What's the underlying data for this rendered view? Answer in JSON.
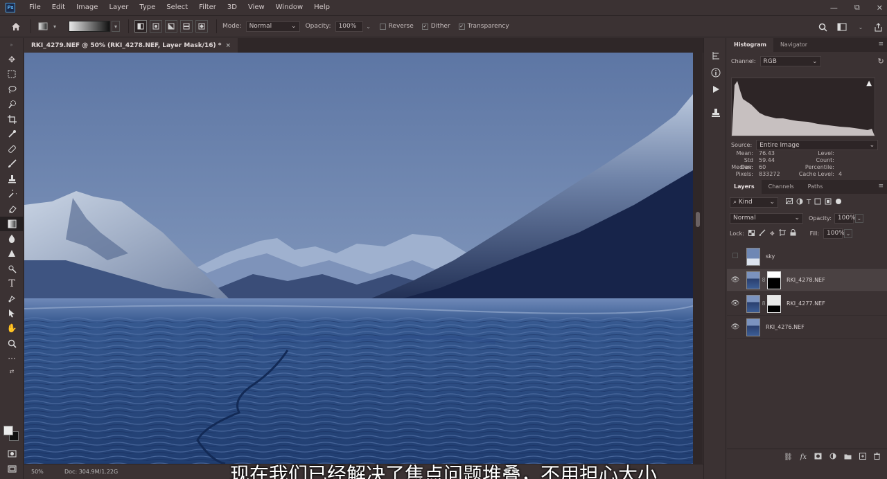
{
  "app": {
    "logo": "Ps"
  },
  "menu": [
    "File",
    "Edit",
    "Image",
    "Layer",
    "Type",
    "Select",
    "Filter",
    "3D",
    "View",
    "Window",
    "Help"
  ],
  "window_controls": [
    "—",
    "⧉",
    "✕"
  ],
  "options": {
    "mode_label": "Mode:",
    "mode_value": "Normal",
    "opacity_label": "Opacity:",
    "opacity_value": "100%",
    "reverse_label": "Reverse",
    "dither_label": "Dither",
    "transparency_label": "Transparency",
    "reverse_checked": false,
    "dither_checked": true,
    "transparency_checked": true
  },
  "document": {
    "tab_title": "RKI_4279.NEF @ 50% (RKI_4278.NEF, Layer Mask/16) *",
    "close": "×"
  },
  "status": {
    "zoom": "50%",
    "doc": "Doc: 304.9M/1.22G"
  },
  "subtitle": "现在我们已经解决了焦点问题堆叠，不用担心大小",
  "histogram": {
    "tabs": [
      "Histogram",
      "Navigator"
    ],
    "channel_label": "Channel:",
    "channel_value": "RGB",
    "source_label": "Source:",
    "source_value": "Entire Image",
    "stats_left": [
      {
        "label": "Mean:",
        "value": "76.43"
      },
      {
        "label": "Std Dev:",
        "value": "59.44"
      },
      {
        "label": "Median:",
        "value": "60"
      },
      {
        "label": "Pixels:",
        "value": "833272"
      }
    ],
    "stats_right": [
      {
        "label": "Level:",
        "value": ""
      },
      {
        "label": "Count:",
        "value": ""
      },
      {
        "label": "Percentile:",
        "value": ""
      },
      {
        "label": "Cache Level:",
        "value": "4"
      }
    ]
  },
  "layers": {
    "tabs": [
      "Layers",
      "Channels",
      "Paths"
    ],
    "filter_kind": "Kind",
    "blend_mode": "Normal",
    "opacity_label": "Opacity:",
    "opacity_value": "100%",
    "lock_label": "Lock:",
    "fill_label": "Fill:",
    "fill_value": "100%",
    "items": [
      {
        "name": "sky",
        "visible": false,
        "has_mask": false,
        "selected": false
      },
      {
        "name": "RKI_4278.NEF",
        "visible": true,
        "has_mask": true,
        "selected": true
      },
      {
        "name": "RKI_4277.NEF",
        "visible": true,
        "has_mask": true,
        "selected": false
      },
      {
        "name": "RKI_4276.NEF",
        "visible": true,
        "has_mask": false,
        "selected": false
      }
    ]
  },
  "colors": {
    "sky_top": "#5d76a4",
    "sky_bottom": "#8ea5c7",
    "water": "#31558f",
    "accent": "#4d9fe0"
  }
}
